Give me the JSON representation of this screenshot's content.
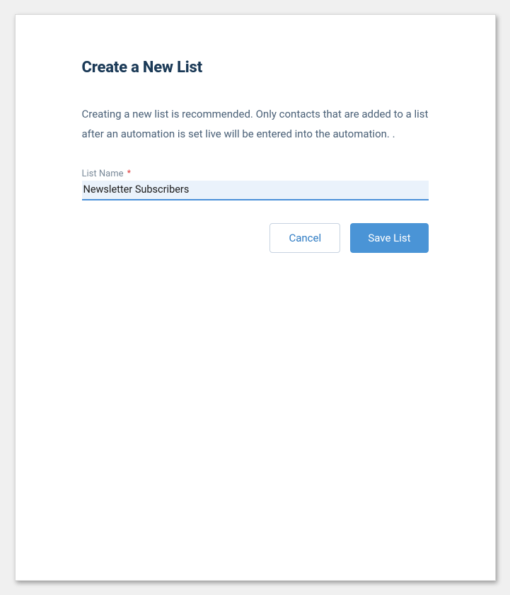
{
  "title": "Create a New List",
  "description": "Creating a new list is recommended. Only contacts that are added to a list after an automation is set live will be entered into the automation. .",
  "form": {
    "list_name_label": "List Name",
    "required_mark": "*",
    "list_name_value": "Newsletter Subscribers"
  },
  "buttons": {
    "cancel": "Cancel",
    "save": "Save List"
  }
}
